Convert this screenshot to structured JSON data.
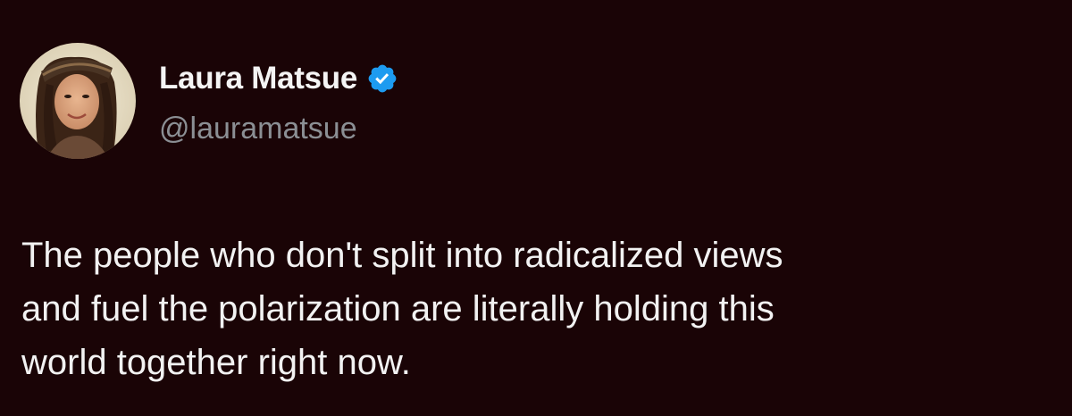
{
  "author": {
    "display_name": "Laura Matsue",
    "handle": "@lauramatsue",
    "verified": true,
    "verified_icon": "verified-badge-icon",
    "verified_color": "#1d9bf0"
  },
  "tweet": {
    "lines": [
      "The people who don't split into radicalized views",
      "and fuel the polarization are literally holding this",
      "world together right now."
    ]
  },
  "theme": {
    "background": "#1a0406",
    "text": "#f2f2f2",
    "secondary_text": "#8b8f94"
  }
}
